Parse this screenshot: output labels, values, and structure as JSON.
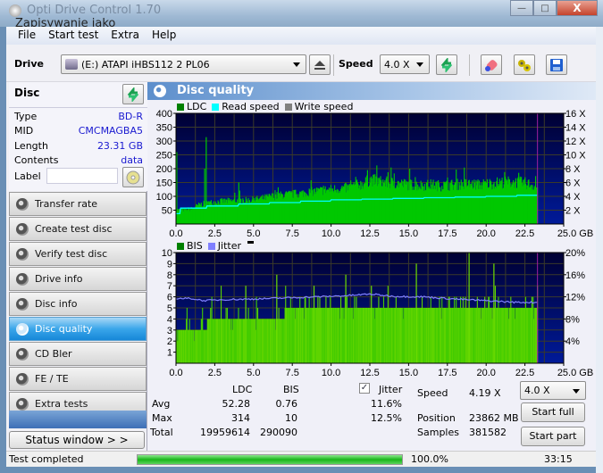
{
  "window": {
    "title": "Opti Drive Control 1.70",
    "overlay_title": "Zapisywanie jako",
    "controls": {
      "minimize": "—",
      "maximize": "□",
      "close": "X"
    }
  },
  "menu": [
    "File",
    "Start test",
    "Extra",
    "Help"
  ],
  "toolbar": {
    "drive_label": "Drive",
    "drive_value": "(E:)   ATAPI iHBS112   2 PL06",
    "speed_label": "Speed",
    "speed_value": "4.0 X",
    "icons": [
      "eject-icon",
      "refresh-icon",
      "erase-icon",
      "settings-icon",
      "save-icon"
    ]
  },
  "disc": {
    "title": "Disc",
    "rows": [
      {
        "label": "Type",
        "value": "BD-R"
      },
      {
        "label": "MID",
        "value": "CMCMAGBA5"
      },
      {
        "label": "Length",
        "value": "23.31 GB"
      },
      {
        "label": "Contents",
        "value": "data"
      }
    ],
    "label_field": "Label",
    "label_value": ""
  },
  "nav": [
    {
      "label": "Transfer rate",
      "active": false
    },
    {
      "label": "Create test disc",
      "active": false
    },
    {
      "label": "Verify test disc",
      "active": false
    },
    {
      "label": "Drive info",
      "active": false
    },
    {
      "label": "Disc info",
      "active": false
    },
    {
      "label": "Disc quality",
      "active": true
    },
    {
      "label": "CD Bler",
      "active": false
    },
    {
      "label": "FE / TE",
      "active": false
    },
    {
      "label": "Extra tests",
      "active": false
    }
  ],
  "status_window_button": "Status window > >",
  "panel_title": "Disc quality",
  "colors": {
    "plot_bg_top": "#000033",
    "plot_bg_bottom": "#001a99",
    "ldc": "#00c800",
    "read_speed": "#00ffff",
    "bis": "#44cc00",
    "jitter": "#8080ff",
    "grid": "#3a3a2a",
    "marker": "#a020a0"
  },
  "chart_data": [
    {
      "type": "area",
      "title": "LDC",
      "legend": [
        "LDC",
        "Read speed",
        "Write speed"
      ],
      "xlabel": "GB",
      "x_ticks": [
        "0.0",
        "2.5",
        "5.0",
        "7.5",
        "10.0",
        "12.5",
        "15.0",
        "17.5",
        "20.0",
        "22.5",
        "25.0 GB"
      ],
      "xlim": [
        0,
        25
      ],
      "y_left_ticks": [
        "50",
        "100",
        "150",
        "200",
        "250",
        "300",
        "350",
        "400"
      ],
      "ylim_left": [
        0,
        400
      ],
      "y_right_ticks": [
        "2 X",
        "4 X",
        "6 X",
        "8 X",
        "10 X",
        "12 X",
        "14 X",
        "16 X"
      ],
      "ylim_right": [
        0,
        16
      ],
      "data_end_gb": 23.31,
      "ldc_series": {
        "x": [
          0,
          0.5,
          1,
          1.5,
          2,
          2.5,
          3,
          3.5,
          4,
          4.5,
          5,
          5.5,
          6,
          6.5,
          7,
          7.5,
          8,
          8.5,
          9,
          9.5,
          10,
          10.5,
          11,
          11.5,
          12,
          12.5,
          13,
          13.5,
          14,
          14.5,
          15,
          15.5,
          16,
          16.5,
          17,
          17.5,
          18,
          18.5,
          19,
          19.5,
          20,
          20.5,
          21,
          21.5,
          22,
          22.5,
          23,
          23.31
        ],
        "y": [
          50,
          52,
          55,
          70,
          75,
          80,
          82,
          83,
          85,
          85,
          88,
          92,
          98,
          102,
          105,
          108,
          110,
          115,
          118,
          122,
          125,
          128,
          130,
          138,
          145,
          160,
          155,
          150,
          148,
          145,
          142,
          140,
          140,
          142,
          138,
          140,
          142,
          145,
          143,
          142,
          145,
          148,
          150,
          152,
          150,
          148,
          140,
          132
        ]
      },
      "ldc_spikes": [
        {
          "x": 0.05,
          "y": 260
        },
        {
          "x": 1.95,
          "y": 314
        },
        {
          "x": 1.85,
          "y": 200
        },
        {
          "x": 4.05,
          "y": 150
        },
        {
          "x": 12.35,
          "y": 195
        },
        {
          "x": 22.1,
          "y": 185
        }
      ],
      "read_speed_series": {
        "x": [
          0,
          0.3,
          2,
          4,
          6,
          8,
          10,
          12,
          14,
          16,
          18,
          20,
          22,
          23.31
        ],
        "y": [
          1.5,
          2.3,
          2.6,
          2.9,
          3.1,
          3.3,
          3.5,
          3.6,
          3.7,
          3.8,
          3.9,
          4.0,
          4.15,
          4.2
        ]
      }
    },
    {
      "type": "area",
      "title": "BIS / Jitter",
      "legend": [
        "BIS",
        "Jitter"
      ],
      "xlabel": "GB",
      "x_ticks": [
        "0.0",
        "2.5",
        "5.0",
        "7.5",
        "10.0",
        "12.5",
        "15.0",
        "17.5",
        "20.0",
        "22.5",
        "25.0 GB"
      ],
      "xlim": [
        0,
        25
      ],
      "y_left_ticks": [
        "1",
        "2",
        "3",
        "4",
        "5",
        "6",
        "7",
        "8",
        "9",
        "10"
      ],
      "ylim_left": [
        0,
        10
      ],
      "y_right_ticks": [
        "4%",
        "8%",
        "12%",
        "16%",
        "20%"
      ],
      "ylim_right": [
        0,
        20
      ],
      "data_end_gb": 23.31,
      "bis_base": {
        "x": [
          0,
          1,
          2,
          5,
          7,
          12.5,
          23.31
        ],
        "y": [
          3,
          3,
          4,
          4,
          5,
          5,
          5
        ]
      },
      "bis_spikes": [
        {
          "x": 6.5,
          "y": 8
        },
        {
          "x": 10.95,
          "y": 8
        },
        {
          "x": 12.6,
          "y": 7
        },
        {
          "x": 15.5,
          "y": 9
        },
        {
          "x": 18.9,
          "y": 10
        },
        {
          "x": 20.5,
          "y": 9
        },
        {
          "x": 4.5,
          "y": 7
        },
        {
          "x": 8.9,
          "y": 7
        }
      ],
      "jitter_series": {
        "x": [
          0,
          1,
          1.8,
          3,
          5,
          7,
          9,
          11,
          12.5,
          14,
          16,
          18,
          20,
          22,
          23.31
        ],
        "y": [
          11.7,
          11.7,
          11.3,
          11.5,
          11.6,
          11.8,
          12.0,
          12.2,
          12.5,
          12.1,
          12.0,
          11.6,
          11.3,
          11.0,
          11.0
        ]
      }
    }
  ],
  "stats": {
    "headers": [
      "LDC",
      "BIS"
    ],
    "jitter_label": "Jitter",
    "jitter_checked": true,
    "rows": [
      {
        "label": "Avg",
        "ldc": "52.28",
        "bis": "0.76",
        "jitter": "11.6%"
      },
      {
        "label": "Max",
        "ldc": "314",
        "bis": "10",
        "jitter": "12.5%"
      },
      {
        "label": "Total",
        "ldc": "19959614",
        "bis": "290090",
        "jitter": ""
      }
    ],
    "speed_label": "Speed",
    "speed_value": "4.19 X",
    "position_label": "Position",
    "position_value": "23862 MB",
    "samples_label": "Samples",
    "samples_value": "381582",
    "speed_select": "4.0 X",
    "start_full": "Start full",
    "start_part": "Start part"
  },
  "statusbar": {
    "text": "Test completed",
    "progress": 100.0,
    "progress_text": "100.0%",
    "time": "33:15"
  }
}
